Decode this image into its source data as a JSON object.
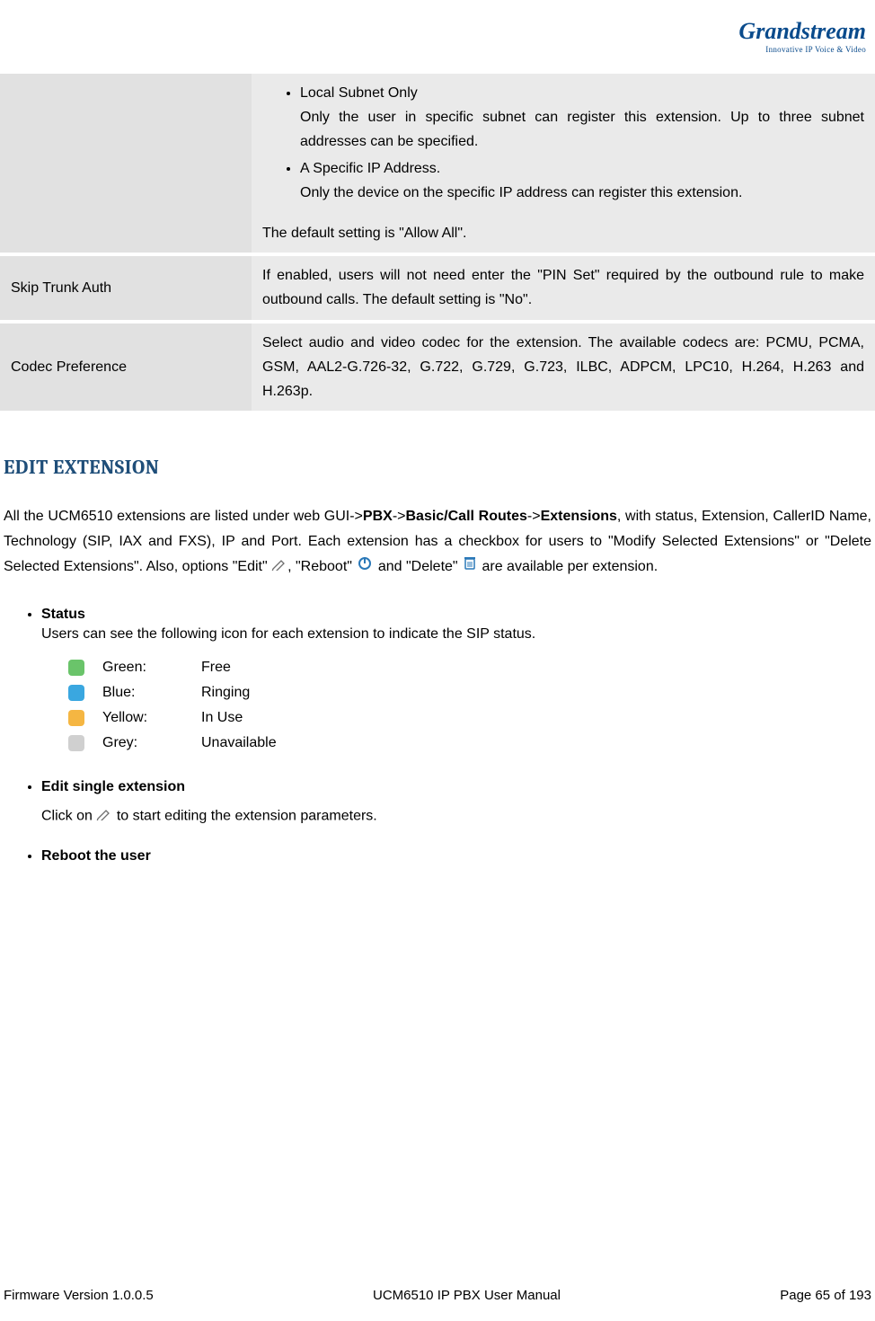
{
  "logo": {
    "main": "Grandstream",
    "sub": "Innovative IP Voice & Video"
  },
  "table": {
    "row0": {
      "bullets": [
        {
          "title": "Local Subnet Only",
          "desc": "Only the user in specific subnet can register this extension. Up to three subnet addresses can be specified."
        },
        {
          "title": "A Specific IP Address.",
          "desc": "Only the device on the specific IP address can register this extension."
        }
      ],
      "default": "The default setting is \"Allow All\"."
    },
    "row1": {
      "label": "Skip Trunk Auth",
      "value": "If enabled, users will not need enter the \"PIN Set\" required by the outbound rule to make outbound calls. The default setting is \"No\"."
    },
    "row2": {
      "label": "Codec Preference",
      "value": "Select audio and video codec for the extension. The available codecs are: PCMU, PCMA, GSM, AAL2-G.726-32, G.722, G.729, G.723, ILBC, ADPCM, LPC10, H.264, H.263 and H.263p."
    }
  },
  "section_title": "EDIT EXTENSION",
  "intro": {
    "part1": "All the UCM6510 extensions are listed under web GUI->",
    "b1": "PBX",
    "sep1": "->",
    "b2": "Basic/Call Routes",
    "sep2": "->",
    "b3": "Extensions",
    "part2": ", with status, Extension, CallerID Name, Technology (SIP, IAX and FXS), IP and Port. Each extension has a checkbox for users to \"Modify Selected Extensions\" or \"Delete Selected Extensions\". Also, options \"Edit\" ",
    "part3": ", \"Reboot\" ",
    "part4": " and \"Delete\" ",
    "part5": " are available per extension."
  },
  "bullets": {
    "status": {
      "title": "Status",
      "desc": "Users can see the following icon for each extension to indicate the SIP status.",
      "rows": [
        {
          "color": "Green:",
          "meaning": "Free"
        },
        {
          "color": "Blue:",
          "meaning": "Ringing"
        },
        {
          "color": "Yellow:",
          "meaning": "In Use"
        },
        {
          "color": "Grey:",
          "meaning": "Unavailable"
        }
      ]
    },
    "edit": {
      "title": "Edit single extension",
      "desc1": "Click on ",
      "desc2": " to start editing the extension parameters."
    },
    "reboot": {
      "title": "Reboot the user"
    }
  },
  "footer": {
    "left": "Firmware Version 1.0.0.5",
    "center": "UCM6510 IP PBX User Manual",
    "right": "Page 65 of 193"
  }
}
